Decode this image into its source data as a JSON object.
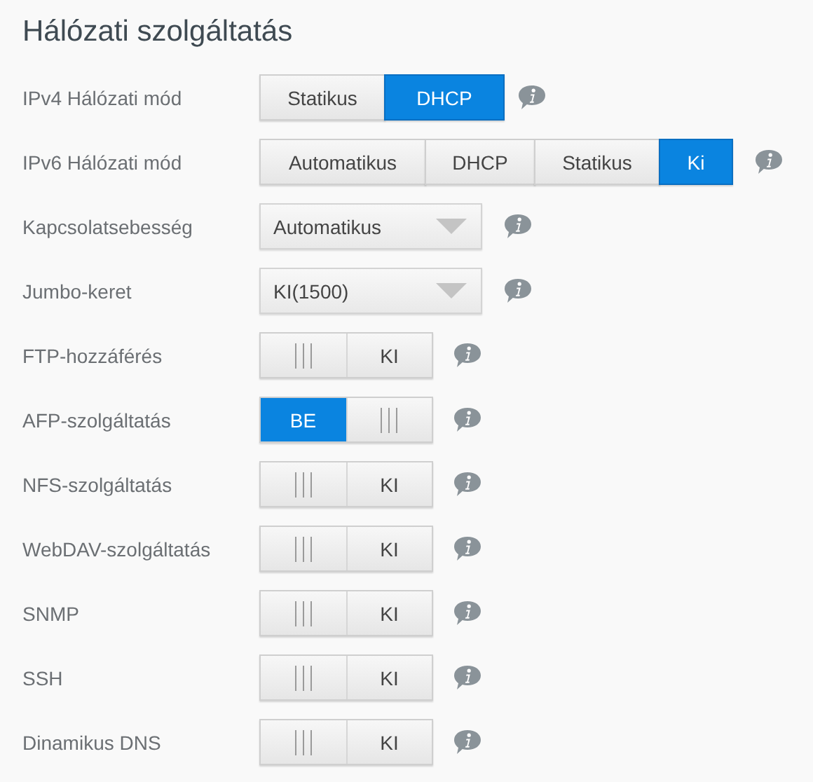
{
  "title": "Hálózati szolgáltatás",
  "rows": [
    {
      "label": "IPv4 Hálózati mód",
      "kind": "segmented",
      "options": [
        {
          "label": "Statikus",
          "selected": false
        },
        {
          "label": "DHCP",
          "selected": true
        }
      ]
    },
    {
      "label": "IPv6 Hálózati mód",
      "kind": "segmented",
      "options": [
        {
          "label": "Automatikus",
          "selected": false
        },
        {
          "label": "DHCP",
          "selected": false
        },
        {
          "label": "Statikus",
          "selected": false
        },
        {
          "label": "Ki",
          "selected": true
        }
      ]
    },
    {
      "label": "Kapcsolatsebesség",
      "kind": "dropdown",
      "value": "Automatikus"
    },
    {
      "label": "Jumbo-keret",
      "kind": "dropdown",
      "value": "KI(1500)"
    },
    {
      "label": "FTP-hozzáférés",
      "kind": "toggle",
      "on": false,
      "text": "KI"
    },
    {
      "label": "AFP-szolgáltatás",
      "kind": "toggle",
      "on": true,
      "text": "BE"
    },
    {
      "label": "NFS-szolgáltatás",
      "kind": "toggle",
      "on": false,
      "text": "KI"
    },
    {
      "label": "WebDAV-szolgáltatás",
      "kind": "toggle",
      "on": false,
      "text": "KI"
    },
    {
      "label": "SNMP",
      "kind": "toggle",
      "on": false,
      "text": "KI"
    },
    {
      "label": "SSH",
      "kind": "toggle",
      "on": false,
      "text": "KI"
    },
    {
      "label": "Dinamikus DNS",
      "kind": "toggle",
      "on": false,
      "text": "KI"
    }
  ]
}
